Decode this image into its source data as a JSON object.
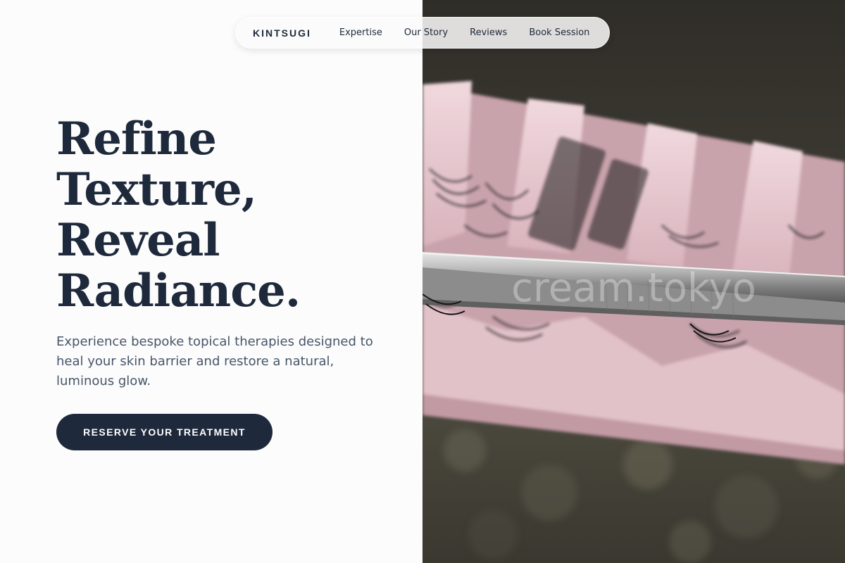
{
  "nav": {
    "brand": "KINTSUGI",
    "links": [
      "Expertise",
      "Our Story",
      "Reviews",
      "Book Session"
    ]
  },
  "hero": {
    "title_lines": [
      "Refine",
      "Texture,",
      "Reveal",
      "Radiance."
    ],
    "subtitle": "Experience bespoke topical therapies designed to heal your skin barrier and restore a natural, luminous glow.",
    "cta_label": "RESERVE YOUR TREATMENT"
  },
  "image": {
    "watermark": "cream.tokyo",
    "subject": "eyelash-extension-tray-with-tweezers"
  },
  "colors": {
    "primary": "#1e293b",
    "body_text": "#475569",
    "background": "#fcfcfc",
    "tray_pink": "#e8c9cf"
  }
}
